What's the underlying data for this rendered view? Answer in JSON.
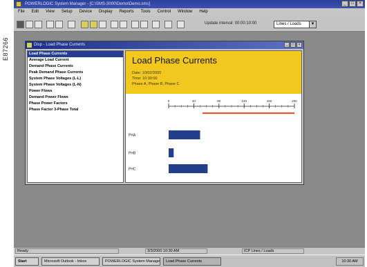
{
  "figure_id": "E87266",
  "app": {
    "title": "POWERLOGIC System Manager - [C:\\SMS-3000\\Demo\\Demo.sms]",
    "menu": [
      "File",
      "Edit",
      "View",
      "Setup",
      "Device",
      "Display",
      "Reports",
      "Tools",
      "Control",
      "Window",
      "Help"
    ]
  },
  "toolbar": {
    "update_label": "Update interval: 00:00:10:00",
    "device_select": "Lines / Loads"
  },
  "child": {
    "title": "Disp - Load Phase Currents",
    "list_items": [
      "Load Phase Currents",
      "Average Load Current",
      "Demand Phase Currents",
      "Peak Demand Phase Currents",
      "System Phase Voltages (L-L)",
      "System Phase Voltages (L-N)",
      "Power Flows",
      "Demand Power Flows",
      "Phase Power Factors",
      "Phase Factor 3-Phase Total"
    ],
    "selected_index": 0
  },
  "panel": {
    "title": "Load Phase Currents",
    "date": "Date: 10/02/2000",
    "time": "Time: 10:30:00",
    "phases": "Phase A, Phase B, Phase C"
  },
  "chart_data": {
    "type": "bar",
    "orientation": "horizontal",
    "categories": [
      "PHA",
      "PHB",
      "PHC"
    ],
    "values": [
      50,
      8,
      62
    ],
    "xlim": [
      0,
      200
    ],
    "ticks": [
      0,
      40,
      80,
      120,
      160,
      200
    ],
    "tick_labels": [
      "0",
      "40",
      "80",
      "120",
      "160",
      "200"
    ],
    "limit_line": {
      "from": 54,
      "to": 200,
      "color": "#e4572e"
    },
    "bar_color": "#233f8c"
  },
  "status": {
    "ready": "Ready",
    "mid": "3/3/2000 10:30 AM",
    "right": "ICP Lines / Loads"
  },
  "taskbar": {
    "start": "Start",
    "tasks": [
      "Microsoft Outlook - Inbox",
      "POWERLOGIC System Manager",
      "Load Phase Currents"
    ],
    "clock": "10:30 AM"
  }
}
